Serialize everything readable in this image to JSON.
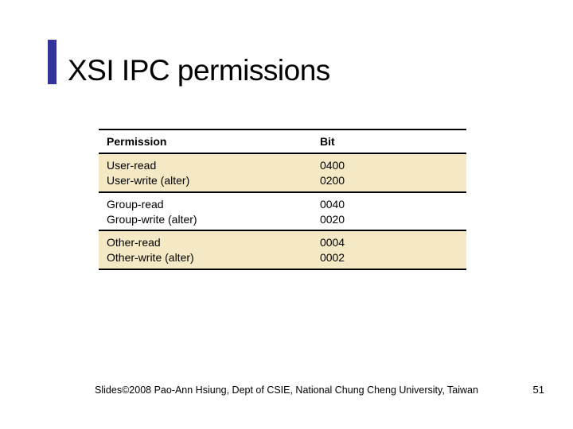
{
  "title": "XSI IPC permissions",
  "table": {
    "headers": {
      "permission": "Permission",
      "bit": "Bit"
    },
    "rows": [
      {
        "permission": "User-read\nUser-write (alter)",
        "bit": "0400\n0200"
      },
      {
        "permission": "Group-read\nGroup-write (alter)",
        "bit": "0040\n0020"
      },
      {
        "permission": "Other-read\nOther-write (alter)",
        "bit": "0004\n0002"
      }
    ]
  },
  "footer": "Slides©2008 Pao-Ann Hsiung, Dept of CSIE, National Chung Cheng University, Taiwan",
  "page_number": "51",
  "chart_data": {
    "type": "table",
    "title": "XSI IPC permissions",
    "columns": [
      "Permission",
      "Bit"
    ],
    "rows": [
      [
        "User-read",
        "0400"
      ],
      [
        "User-write (alter)",
        "0200"
      ],
      [
        "Group-read",
        "0040"
      ],
      [
        "Group-write (alter)",
        "0020"
      ],
      [
        "Other-read",
        "0004"
      ],
      [
        "Other-write (alter)",
        "0002"
      ]
    ]
  }
}
